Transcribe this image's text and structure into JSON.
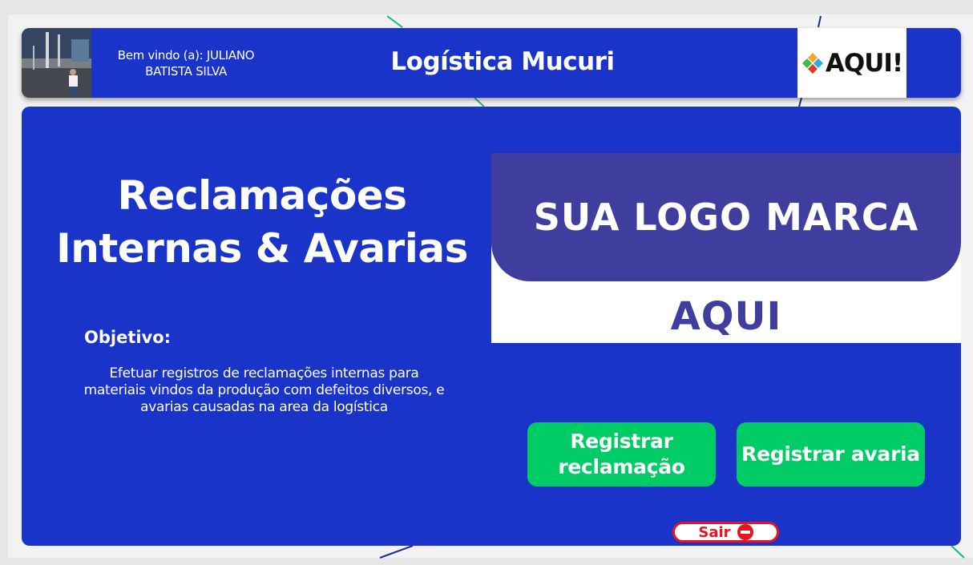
{
  "header": {
    "welcome": "Bem vindo (a): JULIANO BATISTA SILVA",
    "title": "Logística Mucuri",
    "brand": "AQUI!"
  },
  "main": {
    "heading_line1": "Reclamações",
    "heading_line2": "Internas & Avarias",
    "objective_label": "Objetivo:",
    "objective_text": "Efetuar registros de reclamações internas para materiais vindos da produção com defeitos diversos, e avarias causadas na area da logística",
    "logo_line1": "SUA LOGO MARCA",
    "logo_line2": "AQUI"
  },
  "buttons": {
    "register_complaint": "Registrar reclamação",
    "register_damage": "Registrar avaria",
    "exit": "Sair"
  },
  "colors": {
    "primary_blue": "#1a33c8",
    "button_green": "#00cc66",
    "exit_red": "#e8141e",
    "logo_purple": "#3f3d9e"
  },
  "icons": {
    "exit": "stop-icon",
    "brand": "diamond-logo-icon"
  }
}
